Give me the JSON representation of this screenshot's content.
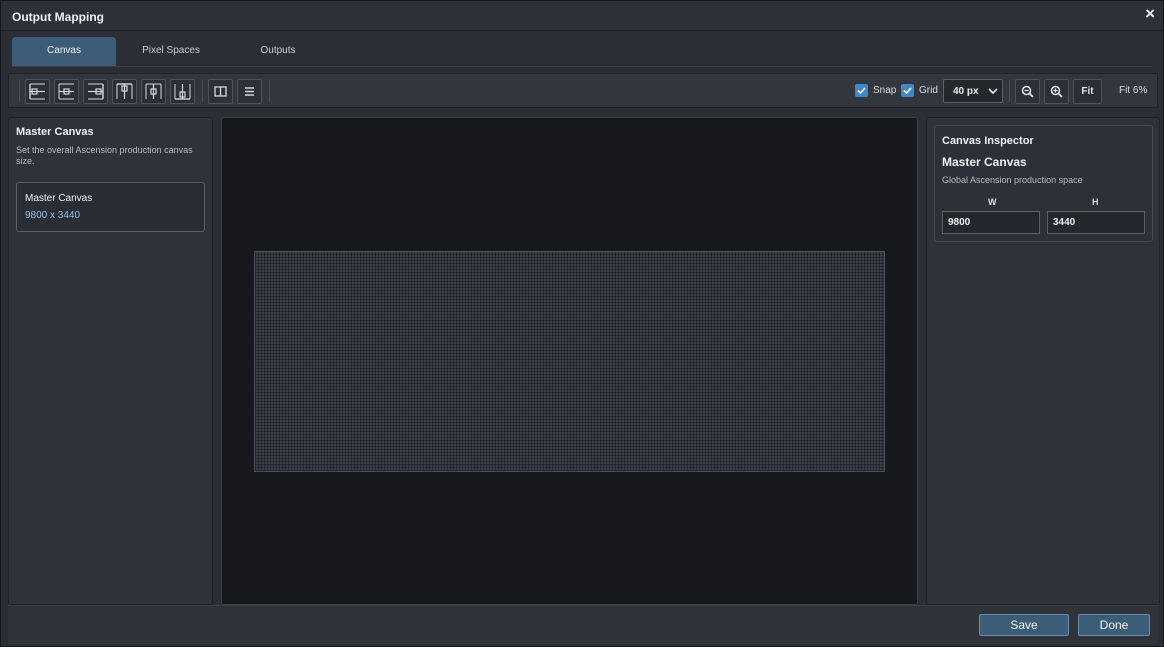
{
  "window": {
    "title": "Output Mapping",
    "close_icon": "×"
  },
  "tabs": [
    {
      "label": "Canvas",
      "active": true
    },
    {
      "label": "Pixel Spaces",
      "active": false
    },
    {
      "label": "Outputs",
      "active": false
    }
  ],
  "toolbar": {
    "align_buttons": [
      "align-left-icon",
      "align-center-horizontal-icon",
      "align-right-icon",
      "align-top-icon",
      "align-center-vertical-icon",
      "align-bottom-icon"
    ],
    "view_buttons": [
      "split-view-icon",
      "list-view-icon"
    ],
    "snap_label": "Snap",
    "snap_checked": true,
    "grid_label": "Grid",
    "grid_checked": true,
    "grid_size": "40 px",
    "zoom_out_icon": "zoom-out-icon",
    "zoom_in_icon": "zoom-in-icon",
    "fit_label": "Fit",
    "zoom_readout": "Fit 6%"
  },
  "left_panel": {
    "title": "Master Canvas",
    "description": "Set the overall Ascension production canvas size.",
    "card": {
      "name": "Master Canvas",
      "size": "9800 x 3440"
    }
  },
  "inspector": {
    "title": "Canvas Inspector",
    "name": "Master Canvas",
    "description": "Global Ascension production space",
    "w_label": "W",
    "h_label": "H",
    "w_value": "9800",
    "h_value": "3440"
  },
  "footer": {
    "save_label": "Save",
    "done_label": "Done"
  },
  "colors": {
    "accent": "#3d5c78",
    "checkbox": "#3f87c9",
    "link": "#8fc0ea",
    "viewport_bg": "#17191d"
  }
}
